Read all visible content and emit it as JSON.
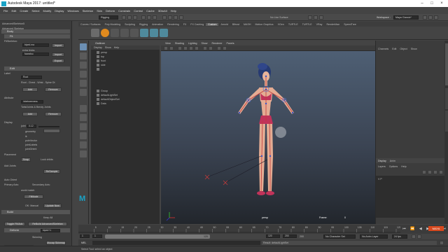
{
  "window": {
    "title": "Autodesk Maya 2017: untitled*"
  },
  "menus": [
    "File",
    "Edit",
    "Create",
    "Select",
    "Modify",
    "Display",
    "Windows",
    "Skeleton",
    "Skin",
    "Deform",
    "Constrain",
    "Control",
    "Cache",
    "3DtoAll",
    "Help"
  ],
  "status": {
    "mode": "Rigging",
    "symmetry": "No Live Surface",
    "workspace_label": "Workspace :",
    "workspace": "Maya Classic*"
  },
  "shelf_tabs": [
    "Curves / Surfaces",
    "Poly Modeling",
    "Sculpting",
    "Rigging",
    "Animation",
    "Rendering",
    "FX",
    "FX Caching",
    "Custom",
    "Arnold",
    "Bifrost",
    "MASH",
    "Motion Graphics",
    "XGen",
    "TURTLE",
    "TURTLE",
    "VRay",
    "RenderMan",
    "SpeedTree"
  ],
  "left_panel": {
    "plugin": "AdvancedSkeleton5",
    "help": "Advanced Skeleton",
    "body": "Body",
    "fit": "Fit",
    "fit_skeleton": "FitSkeleton:",
    "fit_value": "biped.ma",
    "extra": "extra limbs",
    "extra_value": "facealso",
    "import": "Import",
    "import2": "Import",
    "export": "Export",
    "edit": "Edit",
    "label": "Label",
    "label_value": "Root",
    "root_desc": "Root - Chest - Wrist - Spine Dt",
    "add": "Add",
    "remove": "Remove",
    "attribute": "Attribute",
    "attr_value": "inbetweeness",
    "attr_desc": "TwistJoints & Bendy Joints",
    "add2": "Add",
    "remove2": "Remove",
    "display": "Display",
    "joint": "joint",
    "joint_value": "0.12",
    "geometry": "geometry",
    "ik": "ik",
    "poleVector": "poleVector",
    "jointLabels": "jointLabels",
    "jointOrient": "jointOrient",
    "placement": "Placement",
    "snap": "Snap",
    "lock_childs": "Lock childs",
    "add_joints": "Add Joints",
    "resample": "ReSample",
    "auto_orient": "Auto Orient",
    "primary_axis": "Primary Axis:",
    "secondary_axis": "Secondary Axis:",
    "world_match": "world match",
    "fit_mode": "FitMode",
    "ok_manual": "OK: Manual",
    "update_now": "Update Now",
    "build": "Build",
    "keep_all": "Keep All",
    "toggle_fit": "Toggle Fit/Adv",
    "rebuild": "ReBuild AdvancedSkeleton",
    "deform": "Deform",
    "deform_value": "biped+1",
    "skinning": "Skinning",
    "goto_build": "Go to Build Pose",
    "mocap": "Mocap Skinmap"
  },
  "outliner": {
    "title": "Outliner",
    "menu": [
      "Display",
      "Show",
      "Help"
    ],
    "rows": [
      "persp",
      "top",
      "front",
      "side",
      "",
      "Group",
      "defaultLightSet",
      "defaultObjectSet",
      "Data"
    ]
  },
  "viewport": {
    "menu": [
      "View",
      "Shading",
      "Lighting",
      "Show",
      "Renderer",
      "Panels"
    ],
    "camera": "persp",
    "frame_label": "Frame:",
    "frame_value": "0"
  },
  "right_panel": {
    "menu": [
      "Channels",
      "Edit",
      "Object",
      "Show"
    ],
    "display": "Display",
    "anim": "Anim",
    "layers_menu": [
      "Layers",
      "Options",
      "Help"
    ],
    "layer_row": "V P",
    "vtabs": [
      "Channel Box / Layer Editor",
      "Modeling Toolkit",
      "Attribute Editor"
    ]
  },
  "timeline": {
    "ticks": [
      "5",
      "10",
      "15",
      "20",
      "25",
      "30",
      "35",
      "40",
      "45",
      "50",
      "55",
      "60",
      "65",
      "70",
      "75",
      "80",
      "85",
      "90",
      "95",
      "100",
      "105",
      "110",
      "115",
      "120"
    ],
    "current": "0",
    "start": "1",
    "range_start": "1",
    "range_end": "120",
    "end": "120",
    "end2": "200",
    "end3": "200",
    "character_set": "No Character Set",
    "anim_layer": "No Anim Layer",
    "fps": "24 fps"
  },
  "bottom": {
    "mel": "MEL",
    "result": "Result: defaultLightSet",
    "help": "Select Tool: select an object"
  },
  "colors": {
    "accent": "#1aa3c7",
    "shelf_active": "#5d5d5d"
  }
}
